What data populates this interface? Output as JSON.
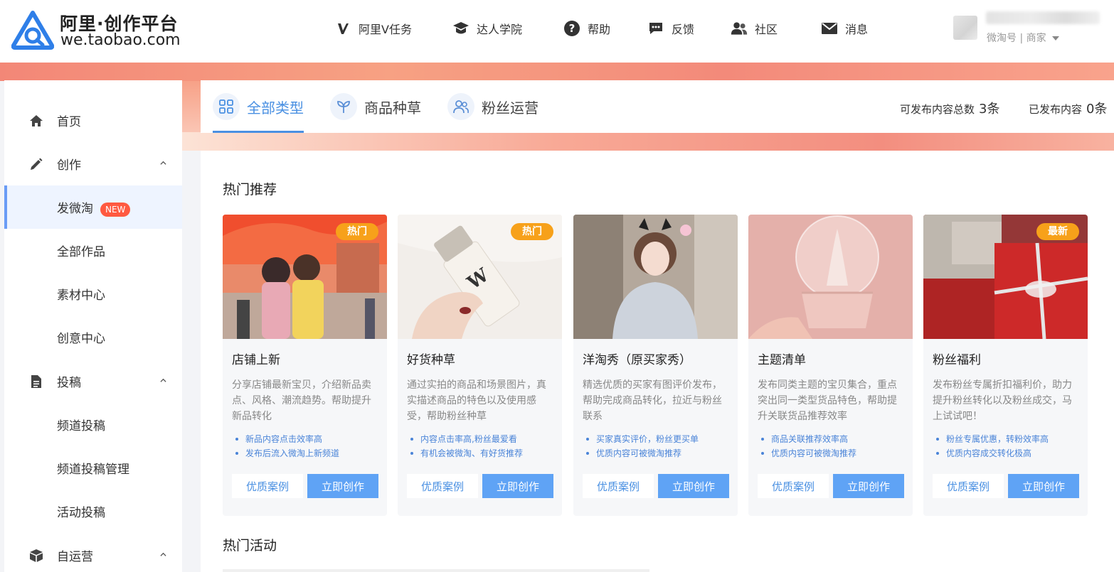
{
  "header": {
    "logo_title": "阿里·创作平台",
    "logo_url": "we.taobao.com",
    "nav": [
      {
        "label": "阿里V任务",
        "icon": "v-icon"
      },
      {
        "label": "达人学院",
        "icon": "graduation-cap-icon"
      },
      {
        "label": "帮助",
        "icon": "help-icon"
      },
      {
        "label": "反馈",
        "icon": "feedback-icon"
      },
      {
        "label": "社区",
        "icon": "community-icon"
      },
      {
        "label": "消息",
        "icon": "mail-icon"
      }
    ],
    "user": {
      "role_text": "微淘号 | 商家"
    }
  },
  "sidebar": {
    "items": [
      {
        "label": "首页",
        "icon": "home-icon"
      },
      {
        "label": "创作",
        "icon": "pencil-icon"
      },
      {
        "label": "发微淘",
        "badge": "NEW"
      },
      {
        "label": "全部作品"
      },
      {
        "label": "素材中心"
      },
      {
        "label": "创意中心"
      },
      {
        "label": "投稿",
        "icon": "document-icon"
      },
      {
        "label": "频道投稿"
      },
      {
        "label": "频道投稿管理"
      },
      {
        "label": "活动投稿"
      },
      {
        "label": "自运营",
        "icon": "box-icon"
      }
    ]
  },
  "tabs": [
    {
      "label": "全部类型",
      "icon": "grid-icon"
    },
    {
      "label": "商品种草",
      "icon": "sprout-icon"
    },
    {
      "label": "粉丝运营",
      "icon": "users-icon"
    }
  ],
  "stats": [
    {
      "label": "可发布内容总数",
      "value": "3条"
    },
    {
      "label": "已发布内容",
      "value": "0条"
    }
  ],
  "main": {
    "hot_title": "热门推荐",
    "activity_title": "热门活动",
    "cards": [
      {
        "title": "店铺上新",
        "tag": "热门",
        "desc": "分享店铺最新宝贝，介绍新品卖点、风格、潮流趋势。帮助提升新品转化",
        "points": [
          "新品内容点击效率高",
          "发布后流入微淘上新频道"
        ],
        "btn_case": "优质案例",
        "btn_create": "立即创作"
      },
      {
        "title": "好货种草",
        "tag": "热门",
        "desc": "通过实拍的商品和场景图片，真实描述商品的特色以及使用感受，帮助粉丝种草",
        "points": [
          "内容点击率高,粉丝最爱看",
          "有机会被微淘、有好货推荐"
        ],
        "btn_case": "优质案例",
        "btn_create": "立即创作"
      },
      {
        "title": "洋淘秀（原买家秀）",
        "tag": "",
        "desc": "精选优质的买家有图评价发布，帮助完成商品转化，拉近与粉丝联系",
        "points": [
          "买家真实评价，粉丝更买单",
          "优质内容可被微淘推荐"
        ],
        "btn_case": "优质案例",
        "btn_create": "立即创作"
      },
      {
        "title": "主题清单",
        "tag": "",
        "desc": "发布同类主题的宝贝集合，重点突出同一类型货品特色，帮助提升关联货品推荐效率",
        "points": [
          "商品关联推荐效率高",
          "优质内容可被微淘推荐"
        ],
        "btn_case": "优质案例",
        "btn_create": "立即创作"
      },
      {
        "title": "粉丝福利",
        "tag": "最新",
        "desc": "发布粉丝专属折扣福利价，助力提升粉丝转化以及粉丝成交，马上试试吧！",
        "points": [
          "粉丝专属优惠，转粉效率高",
          "优质内容成交转化极高"
        ],
        "btn_case": "优质案例",
        "btn_create": "立即创作"
      }
    ]
  },
  "colors": {
    "accent": "#4a90e2",
    "button_primary": "#5fa3f5",
    "tag_orange": "#f7a11a",
    "badge_new": "#ff5a40",
    "banner": "#f38e7f"
  }
}
